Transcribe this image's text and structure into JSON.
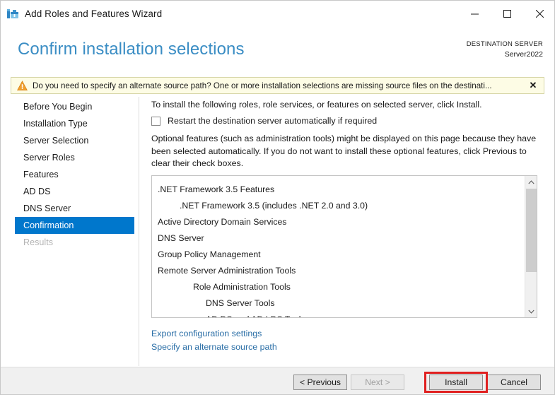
{
  "window": {
    "title": "Add Roles and Features Wizard",
    "app_icon": "toolbox-icon",
    "controls": {
      "minimize": "–",
      "maximize": "□",
      "close": "✕"
    }
  },
  "header": {
    "page_title": "Confirm installation selections",
    "destination_label": "DESTINATION SERVER",
    "destination_server": "Server2022",
    "accent_color": "#3a8dc4"
  },
  "warning": {
    "icon": "warning-triangle-icon",
    "text": "Do you need to specify an alternate source path? One or more installation selections are missing source files on the destinati...",
    "close_label": "✕",
    "background_color": "#fdfce5",
    "border_color": "#d7d7a8"
  },
  "sidebar": {
    "items": [
      {
        "label": "Before You Begin",
        "state": "normal"
      },
      {
        "label": "Installation Type",
        "state": "normal"
      },
      {
        "label": "Server Selection",
        "state": "normal"
      },
      {
        "label": "Server Roles",
        "state": "normal"
      },
      {
        "label": "Features",
        "state": "normal"
      },
      {
        "label": "AD DS",
        "state": "normal"
      },
      {
        "label": "DNS Server",
        "state": "normal"
      },
      {
        "label": "Confirmation",
        "state": "selected"
      },
      {
        "label": "Results",
        "state": "disabled"
      }
    ],
    "selected_color": "#0077cc"
  },
  "main": {
    "intro": "To install the following roles, role services, or features on selected server, click Install.",
    "restart_checkbox": {
      "label": "Restart the destination server automatically if required",
      "checked": false
    },
    "optional_note": "Optional features (such as administration tools) might be displayed on this page because they have been selected automatically. If you do not want to install these optional features, click Previous to clear their check boxes.",
    "selection_list": [
      {
        "text": ".NET Framework 3.5 Features",
        "indent": 0
      },
      {
        "text": ".NET Framework 3.5 (includes .NET 2.0 and 3.0)",
        "indent": 1
      },
      {
        "text": "Active Directory Domain Services",
        "indent": 0
      },
      {
        "text": "DNS Server",
        "indent": 0
      },
      {
        "text": "Group Policy Management",
        "indent": 0
      },
      {
        "text": "Remote Server Administration Tools",
        "indent": 0
      },
      {
        "text": "Role Administration Tools",
        "indent": 2
      },
      {
        "text": "DNS Server Tools",
        "indent": 3
      },
      {
        "text": "AD DS and AD LDS Tools",
        "indent": 3
      }
    ],
    "scrollbar": {
      "up_arrow": "⌃",
      "down_arrow": "⌄"
    },
    "links": [
      "Export configuration settings",
      "Specify an alternate source path"
    ]
  },
  "footer": {
    "buttons": [
      {
        "label": "< Previous",
        "state": "enabled"
      },
      {
        "label": "Next >",
        "state": "disabled"
      },
      {
        "label": "Install",
        "state": "enabled"
      },
      {
        "label": "Cancel",
        "state": "enabled"
      }
    ]
  },
  "annotation": {
    "highlight_target": "Install",
    "highlight_color": "#e02020"
  }
}
